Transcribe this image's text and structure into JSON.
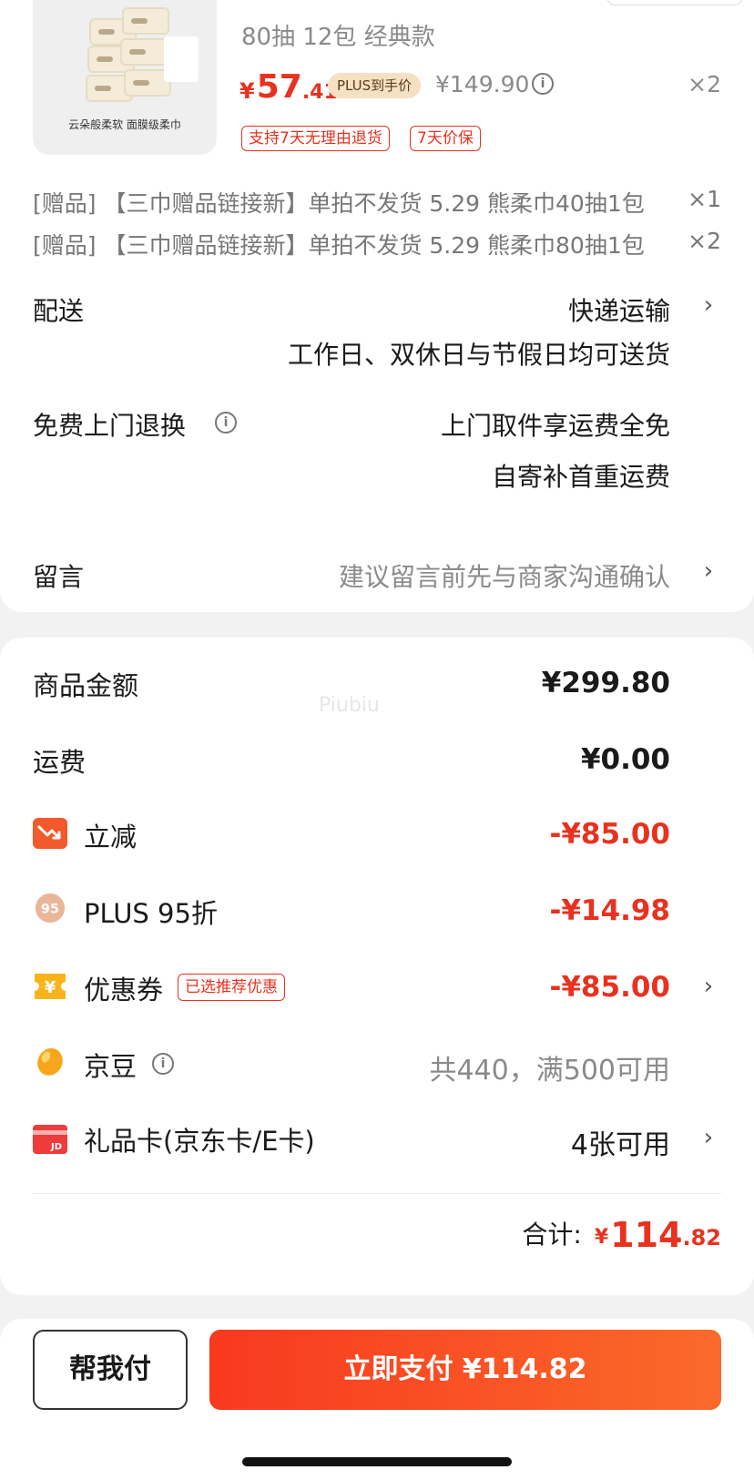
{
  "product": {
    "image_tagline": "云朵般柔软 面膜级柔巾",
    "spec": "80抽 12包 经典款",
    "price": {
      "currency": "¥",
      "integer": "57",
      "decimal": ".41"
    },
    "plus_tag": "PLUS到手价",
    "original_price": "¥149.90",
    "quantity": "×2",
    "services": [
      "支持7天无理由退货",
      "7天价保"
    ]
  },
  "gifts": [
    {
      "text": "[赠品] 【三巾赠品链接新】单拍不发货 5.29 熊柔巾40抽1包",
      "qty": "×1"
    },
    {
      "text": "[赠品] 【三巾赠品链接新】单拍不发货 5.29 熊柔巾80抽1包",
      "qty": "×2"
    }
  ],
  "delivery": {
    "label": "配送",
    "method": "快递运输",
    "note": "工作日、双休日与节假日均可送货"
  },
  "return_service": {
    "label": "免费上门退换",
    "line1": "上门取件享运费全免",
    "line2": "自寄补首重运费"
  },
  "message": {
    "label": "留言",
    "placeholder": "建议留言前先与商家沟通确认"
  },
  "watermark": "Piubiu",
  "summary": {
    "goods_label": "商品金额",
    "goods_value": "¥299.80",
    "shipping_label": "运费",
    "shipping_value": "¥0.00",
    "instant_label": "立减",
    "instant_value": "-¥85.00",
    "plus_label": "PLUS 95折",
    "plus_icon_text": "95",
    "plus_value": "-¥14.98",
    "coupon_label": "优惠券",
    "coupon_badge": "已选推荐优惠",
    "coupon_value": "-¥85.00",
    "coupon_icon_text": "¥",
    "jingdou_label": "京豆",
    "jingdou_value": "共440，满500可用",
    "giftcard_label": "礼品卡(京东卡/E卡)",
    "giftcard_icon_text": "JD",
    "giftcard_value": "4张可用"
  },
  "total": {
    "label": "合计:",
    "currency": "¥",
    "integer": "114",
    "decimal": ".82"
  },
  "actions": {
    "help_pay": "帮我付",
    "pay_now": "立即支付 ¥114.82"
  },
  "colors": {
    "accent": "#e8321f",
    "plus_tag_bg": "#f6e0c4"
  }
}
